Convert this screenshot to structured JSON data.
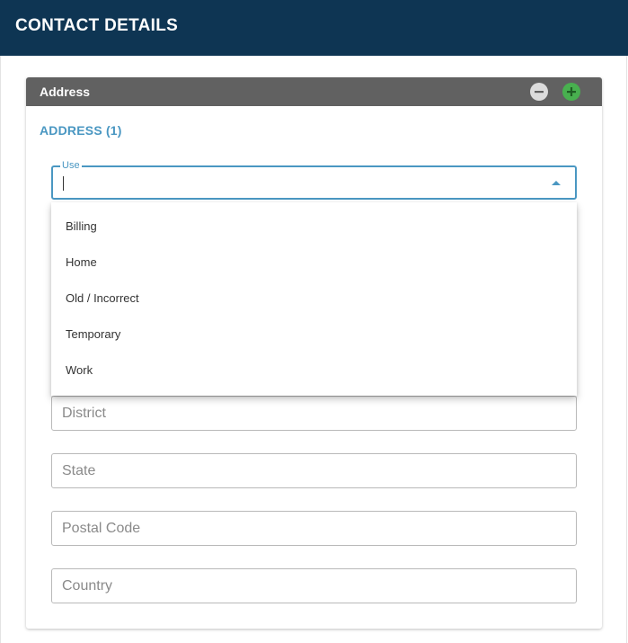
{
  "header": {
    "title": "CONTACT DETAILS"
  },
  "card": {
    "title": "Address",
    "section_title": "ADDRESS (1)"
  },
  "use_select": {
    "label": "Use",
    "value": "",
    "options": [
      "Billing",
      "Home",
      "Old / Incorrect",
      "Temporary",
      "Work"
    ]
  },
  "fields": {
    "district": {
      "placeholder": "District"
    },
    "state": {
      "placeholder": "State"
    },
    "postal_code": {
      "placeholder": "Postal Code"
    },
    "country": {
      "placeholder": "Country"
    }
  },
  "colors": {
    "header_bg": "#0e3553",
    "card_header_bg": "#616161",
    "accent": "#4a97c2",
    "add_button": "#48b04f",
    "remove_button": "#dcdcdc"
  },
  "icons": {
    "remove": "minus-circle-icon",
    "add": "plus-circle-icon",
    "select_arrow": "triangle-up-icon"
  }
}
